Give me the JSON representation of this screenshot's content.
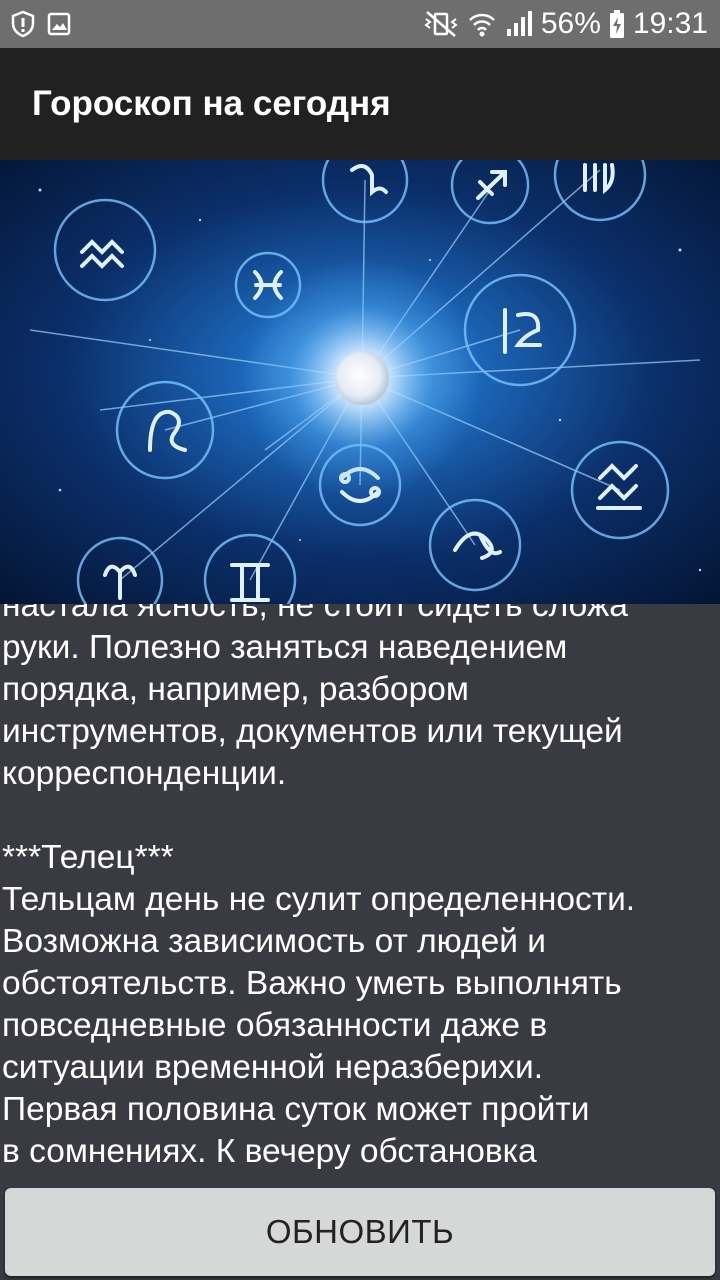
{
  "status_bar": {
    "battery": "56%",
    "time": "19:31",
    "icons": [
      "shield-alert-icon",
      "image-icon",
      "vibrate-mute-icon",
      "wifi-icon",
      "cell-signal-icon",
      "battery-charging-icon"
    ]
  },
  "app_bar": {
    "title": "Гороскоп на сегодня"
  },
  "hero": {
    "icon": "zodiac-wheel-image"
  },
  "content": {
    "text": "настала ясность, не стоит сидеть сложа\nруки. Полезно заняться наведением\nпорядка, например, разбором\nинструментов, документов или текущей\nкорреспонденции.\n\n***Телец***\nТельцам день не сулит определенности.\nВозможна зависимость от людей и\nобстоятельств. Важно уметь выполнять\nповседневные обязанности даже в\nситуации временной неразберихи.\nПервая половина суток может пройти\nв сомнениях. К вечеру обстановка"
  },
  "refresh_button": {
    "label": "ОБНОВИТЬ"
  },
  "colors": {
    "status_bar": "#6e6e6e",
    "app_bar": "#212121",
    "background": "#3a3b42",
    "button": "#d6d7d7"
  }
}
